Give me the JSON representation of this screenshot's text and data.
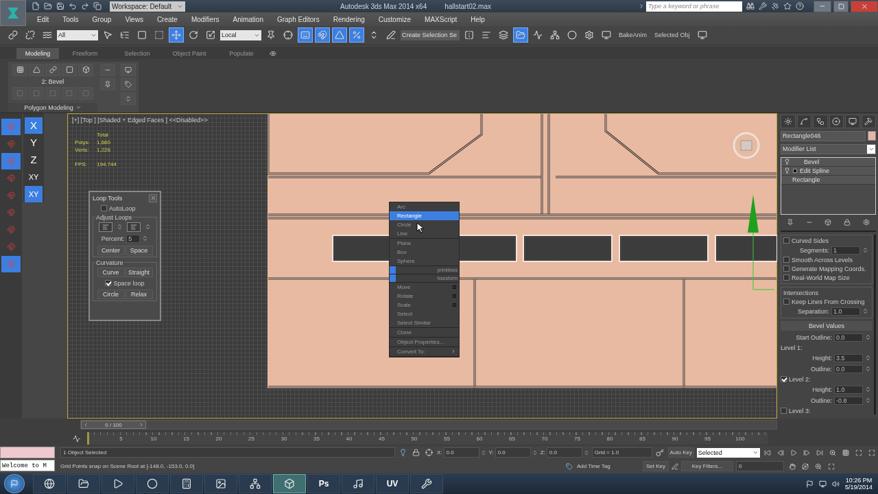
{
  "title_bar": {
    "workspace": "Workspace: Default",
    "app_title": "Autodesk 3ds Max  2014 x64",
    "file_name": "hallstart02.max",
    "search": {
      "placeholder": "Type a keyword or phrase"
    }
  },
  "menu": [
    "Edit",
    "Tools",
    "Group",
    "Views",
    "Create",
    "Modifiers",
    "Animation",
    "Graph Editors",
    "Rendering",
    "Customize",
    "MAXScript",
    "Help"
  ],
  "main_toolbar": [
    {
      "kind": "button",
      "on": false
    },
    {
      "kind": "button",
      "on": false
    },
    {
      "kind": "button",
      "on": false
    },
    {
      "kind": "dropdown",
      "value": "All"
    },
    {
      "kind": "button",
      "on": false
    },
    {
      "kind": "button",
      "on": false
    },
    {
      "kind": "button",
      "on": false
    },
    {
      "kind": "button",
      "on": false
    },
    {
      "kind": "button",
      "on": true
    },
    {
      "kind": "button",
      "on": false
    },
    {
      "kind": "button",
      "on": false
    },
    {
      "kind": "dropdown",
      "value": "Local"
    },
    {
      "kind": "button",
      "on": false
    },
    {
      "kind": "button",
      "on": false
    },
    {
      "kind": "button",
      "on": true
    },
    {
      "kind": "button",
      "on": true
    },
    {
      "kind": "button",
      "on": true
    },
    {
      "kind": "button",
      "on": true
    },
    {
      "kind": "button",
      "on": false
    },
    {
      "kind": "button",
      "on": false
    },
    {
      "kind": "dropdown",
      "value": "Create Selection Se"
    },
    {
      "kind": "button",
      "on": false
    },
    {
      "kind": "button",
      "on": false
    },
    {
      "kind": "button",
      "on": false
    },
    {
      "kind": "button",
      "on": true
    },
    {
      "kind": "button",
      "on": false
    },
    {
      "kind": "button",
      "on": false
    },
    {
      "kind": "button",
      "on": false
    },
    {
      "kind": "button",
      "on": false
    },
    {
      "kind": "button",
      "on": false
    },
    {
      "kind": "label",
      "text": "BakeAnim"
    },
    {
      "kind": "label",
      "text": "Selected Obj"
    },
    {
      "kind": "button",
      "on": false
    }
  ],
  "ribbon": {
    "tabs": [
      {
        "label": "Modeling",
        "selected": true
      },
      {
        "label": "Freeform",
        "selected": false
      },
      {
        "label": "Selection",
        "selected": false
      },
      {
        "label": "Object Paint",
        "selected": false
      },
      {
        "label": "Populate",
        "selected": false
      }
    ],
    "stack_label": "2: Bevel",
    "group_title": "Polygon Modeling"
  },
  "snap_toolbar": [
    {
      "on": true
    },
    {
      "on": false
    },
    {
      "on": true
    },
    {
      "on": false
    },
    {
      "on": false
    },
    {
      "on": false
    },
    {
      "on": false
    },
    {
      "on": false
    },
    {
      "on": true
    }
  ],
  "axis_toolbar": [
    {
      "label": "X",
      "selected": true
    },
    {
      "label": "Y",
      "selected": false
    },
    {
      "label": "Z",
      "selected": false
    },
    {
      "label": "XY",
      "selected": false
    },
    {
      "label": "XY",
      "selected": true
    }
  ],
  "viewport": {
    "label": "[+] [Top ] [Shaded + Edged Faces ]  <<Disabled>>",
    "stats_heading": "Total",
    "stats": [
      {
        "name": "Polys:",
        "value": "1,660"
      },
      {
        "name": "Verts:",
        "value": "1,226"
      },
      {
        "name": "FPS:",
        "value": "194.744"
      }
    ]
  },
  "loop_tools": {
    "title": "Loop Tools",
    "autoloop": {
      "label": "AutoLoop",
      "checked": false
    },
    "adjust_title": "Adjust Loops",
    "percent_label": "Percent:",
    "percent": "5",
    "adjust_buttons": [
      "Center",
      "Space"
    ],
    "curvature_title": "Curvature",
    "curvature_buttons": [
      "Curve",
      "Straight"
    ],
    "space_loop": {
      "label": "Space loop",
      "checked": true
    },
    "shape_buttons": [
      "Circle",
      "Relax"
    ]
  },
  "quad_menu": [
    {
      "items": [
        {
          "kind": "item",
          "label": "Arc",
          "selected": false
        },
        {
          "kind": "item",
          "label": "Rectangle",
          "selected": true
        },
        {
          "kind": "item",
          "label": "Circle",
          "selected": false
        },
        {
          "kind": "item",
          "label": "Line",
          "selected": false
        }
      ]
    },
    {
      "items": [
        {
          "kind": "item",
          "label": "Plane",
          "selected": false
        },
        {
          "kind": "item",
          "label": "Box",
          "selected": false
        },
        {
          "kind": "item",
          "label": "Sphere",
          "selected": false
        }
      ]
    },
    {
      "items": [
        {
          "kind": "header",
          "label": "primitives"
        }
      ]
    },
    {
      "items": [
        {
          "kind": "header",
          "label": "transform"
        }
      ]
    },
    {
      "items": [
        {
          "kind": "option",
          "label": "Move",
          "selected": false
        },
        {
          "kind": "option",
          "label": "Rotate",
          "selected": false
        },
        {
          "kind": "option",
          "label": "Scale",
          "selected": false
        },
        {
          "kind": "item",
          "label": "Select",
          "selected": false
        },
        {
          "kind": "item",
          "label": "Select Similar",
          "selected": false
        }
      ]
    },
    {
      "items": [
        {
          "kind": "item",
          "label": "Clone",
          "selected": false
        }
      ]
    },
    {
      "items": [
        {
          "kind": "item",
          "label": "Object Properties...",
          "selected": false
        }
      ]
    },
    {
      "items": [
        {
          "kind": "submenu",
          "label": "Convert To:",
          "selected": false
        }
      ]
    }
  ],
  "command_panel": {
    "object_name": "Rectangle046",
    "modifier_list": "Modifier List",
    "stack": [
      {
        "kind": "modifier",
        "label": "Bevel"
      },
      {
        "kind": "expandable",
        "label": "Edit Spline"
      },
      {
        "kind": "base",
        "label": "Rectangle"
      }
    ],
    "surface": [
      {
        "kind": "checkbox",
        "label": "Curved Sides",
        "checked": false
      },
      {
        "kind": "spinner",
        "label": "Segments:",
        "value": "1"
      },
      {
        "kind": "checkbox",
        "label": "Smooth Across Levels",
        "checked": false
      },
      {
        "kind": "checkbox",
        "label": "Generate Mapping Coords.",
        "checked": false
      },
      {
        "kind": "checkbox",
        "label": "Real-World Map Size",
        "checked": false
      }
    ],
    "intersections_title": "Intersections",
    "intersections": [
      {
        "kind": "checkbox",
        "label": "Keep Lines From Crossing",
        "checked": false
      },
      {
        "kind": "spinner",
        "label": "Separation:",
        "value": "1.0"
      }
    ],
    "bevel_title": "Bevel Values",
    "bevel": [
      {
        "kind": "spinner",
        "label": "Start Outline:",
        "value": "0.0"
      },
      {
        "kind": "heading",
        "label": "Level 1:"
      },
      {
        "kind": "spinner",
        "label": "Height:",
        "value": "3.5"
      },
      {
        "kind": "spinner",
        "label": "Outline:",
        "value": "0.0"
      },
      {
        "kind": "checkbox",
        "label": "Level 2:",
        "checked": true
      },
      {
        "kind": "spinner",
        "label": "Height:",
        "value": "1.0"
      },
      {
        "kind": "spinner",
        "label": "Outline:",
        "value": "-0.8"
      },
      {
        "kind": "checkbox",
        "label": "Level 3:",
        "checked": false
      }
    ]
  },
  "timeline": {
    "slider": "0 / 100",
    "level": 0,
    "ticks": [
      "5",
      "10",
      "15",
      "20",
      "25",
      "30",
      "35",
      "40",
      "45",
      "50",
      "55",
      "60",
      "65",
      "70",
      "75",
      "80",
      "85",
      "90",
      "95",
      "100"
    ]
  },
  "status": {
    "listener": "Welcome to M",
    "selection": "1 Object Selected",
    "prompt": "Grid Points snap on Scene Root at [-148.0, -153.0, 0.0]",
    "coords": [
      {
        "axis": "X:",
        "value": "0.0"
      },
      {
        "axis": "Y:",
        "value": "0.0"
      },
      {
        "axis": "Z:",
        "value": "0.0"
      }
    ],
    "grid": "Grid = 1.0",
    "add_time_tag": "Add Time Tag",
    "auto_key": "Auto Key",
    "key_mode": "Selected",
    "set_key": "Set Key",
    "key_filters": "Key Filters...",
    "frame": "0"
  },
  "taskbar": {
    "apps": [
      {
        "kind": "browser"
      },
      {
        "kind": "folder"
      },
      {
        "kind": "media"
      },
      {
        "kind": "globe"
      },
      {
        "kind": "calculator"
      },
      {
        "kind": "photos"
      },
      {
        "kind": "network"
      },
      {
        "kind": "max"
      },
      {
        "kind": "text",
        "label": "Ps"
      },
      {
        "kind": "music"
      },
      {
        "kind": "text",
        "label": "UV"
      },
      {
        "kind": "tool"
      }
    ],
    "time": "10:26 PM",
    "date": "5/19/2014"
  }
}
